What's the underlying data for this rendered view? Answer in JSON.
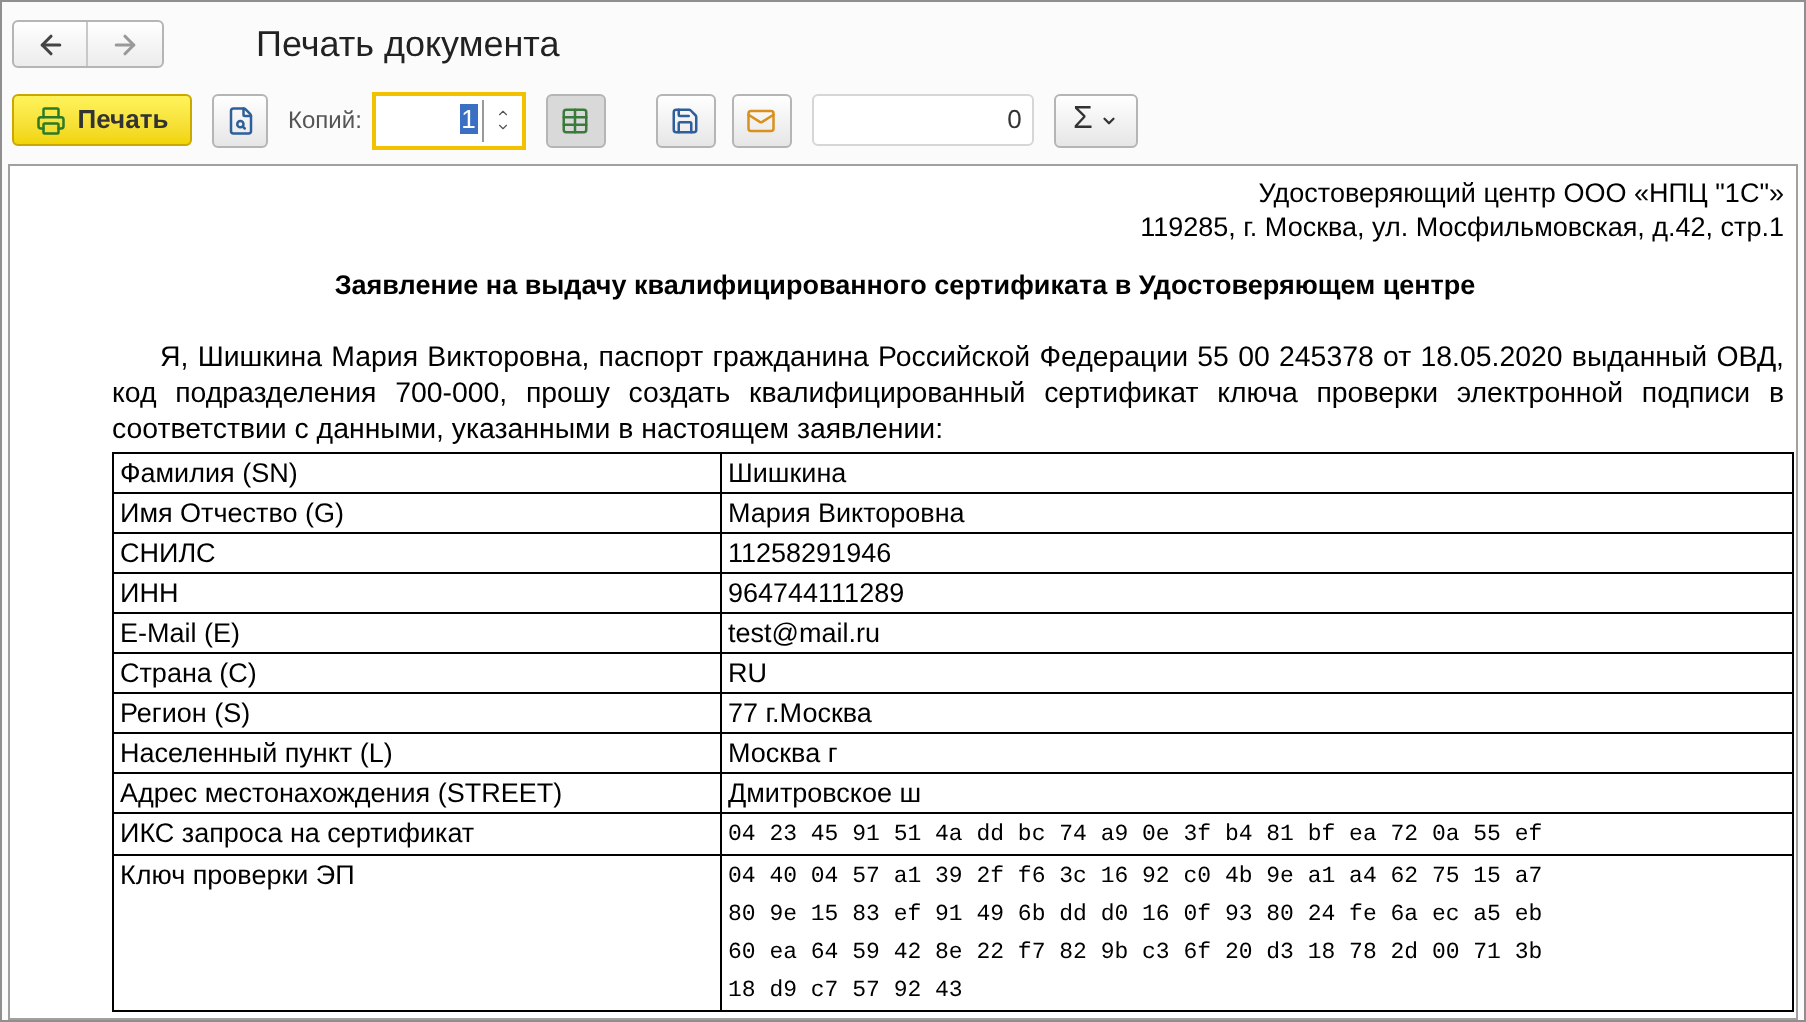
{
  "title": "Печать документа",
  "toolbar": {
    "print_label": "Печать",
    "copies_label": "Копий:",
    "copies_value": "1",
    "counter_value": "0",
    "sum_symbol": "Σ"
  },
  "document": {
    "issuer_lines": [
      "Удостоверяющий центр ООО «НПЦ \"1С\"»",
      "119285, г. Москва, ул. Мосфильмовская, д.42, стр.1"
    ],
    "heading": "Заявление на выдачу квалифицированного сертификата в Удостоверяющем центре",
    "paragraph": "Я, Шишкина Мария Викторовна, паспорт гражданина Российской Федерации 55 00 245378 от 18.05.2020 выданный ОВД, код подразделения 700-000, прошу создать квалифицированный сертификат ключа проверки электронной подписи в соответствии с данными, указанными в настоящем заявлении:",
    "rows": [
      {
        "label": "Фамилия (SN)",
        "kind": "text",
        "lines": [
          "Шишкина"
        ]
      },
      {
        "label": "Имя Отчество (G)",
        "kind": "text",
        "lines": [
          "Мария Викторовна"
        ]
      },
      {
        "label": "СНИЛС",
        "kind": "text",
        "lines": [
          "11258291946"
        ]
      },
      {
        "label": "ИНН",
        "kind": "text",
        "lines": [
          "964744111289"
        ]
      },
      {
        "label": "E-Mail (E)",
        "kind": "text",
        "lines": [
          "test@mail.ru"
        ]
      },
      {
        "label": "Страна (C)",
        "kind": "text",
        "lines": [
          "RU"
        ]
      },
      {
        "label": "Регион (S)",
        "kind": "text",
        "lines": [
          "77 г.Москва"
        ]
      },
      {
        "label": "Населенный пункт (L)",
        "kind": "text",
        "lines": [
          "Москва г"
        ]
      },
      {
        "label": "Адрес местонахождения (STREET)",
        "kind": "text",
        "lines": [
          "Дмитровское ш"
        ]
      },
      {
        "label": "ИКС запроса на сертификат",
        "kind": "hex",
        "lines": [
          "04 23 45 91 51 4a dd bc 74 a9 0e 3f b4 81 bf ea 72 0a 55 ef"
        ]
      },
      {
        "label": "Ключ проверки ЭП",
        "kind": "hex",
        "lines": [
          "04 40 04 57 a1 39 2f f6 3c 16 92 c0 4b 9e a1 a4 62 75 15 a7",
          "80 9e 15 83 ef 91 49 6b dd d0 16 0f 93 80 24 fe 6a ec a5 eb",
          "60 ea 64 59 42 8e 22 f7 82 9b c3 6f 20 d3 18 78 2d 00 71 3b",
          "18 d9 c7 57 92 43"
        ]
      }
    ]
  }
}
